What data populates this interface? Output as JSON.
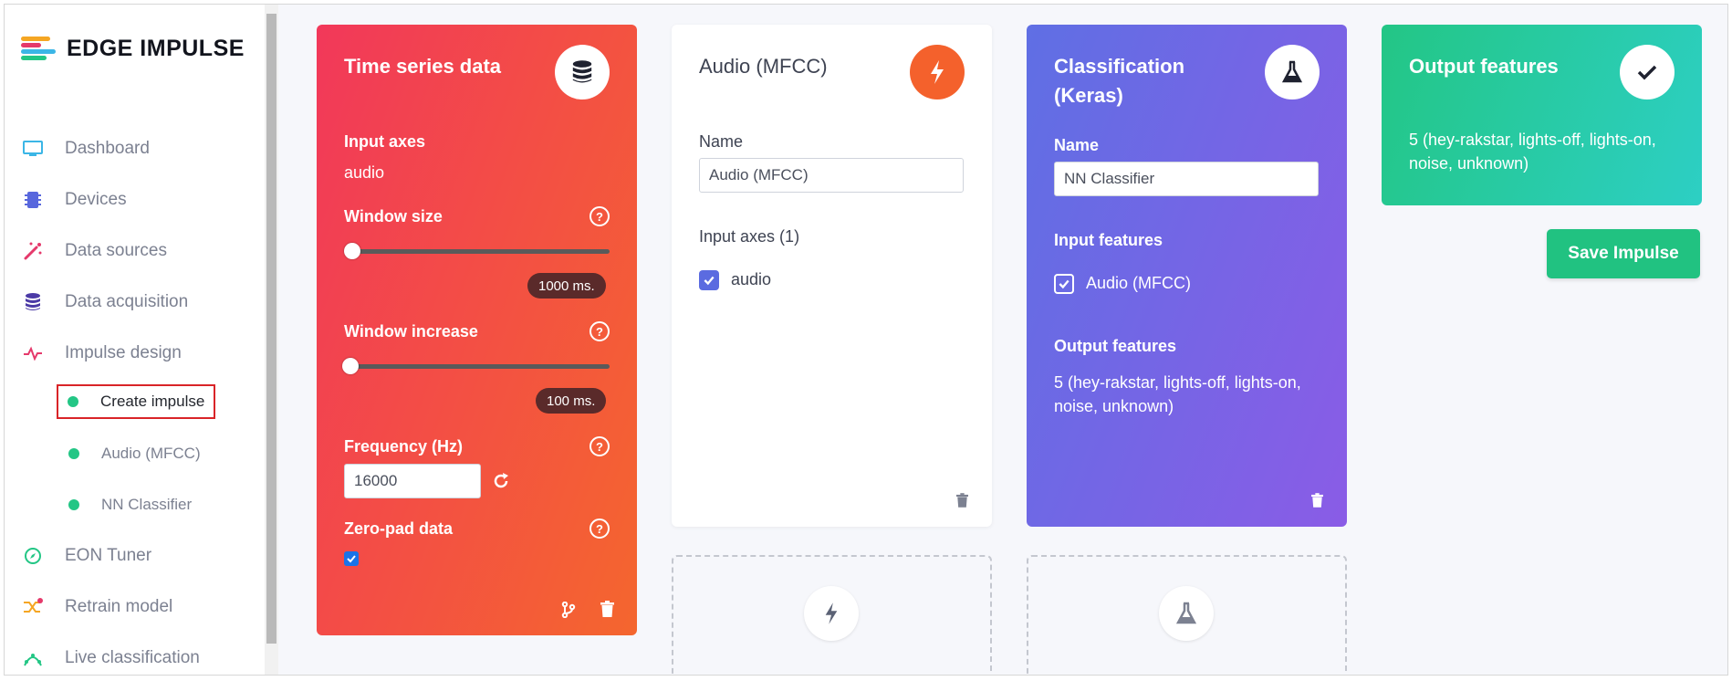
{
  "brand": {
    "name": "EDGE IMPULSE"
  },
  "sidebar": {
    "items": [
      {
        "label": "Dashboard",
        "icon": "monitor-icon",
        "color": "#3bb6e6"
      },
      {
        "label": "Devices",
        "icon": "chip-icon",
        "color": "#5867dd"
      },
      {
        "label": "Data sources",
        "icon": "magic-wand-icon",
        "color": "#e5396b"
      },
      {
        "label": "Data acquisition",
        "icon": "database-icon",
        "color": "#4b3aa6"
      },
      {
        "label": "Impulse design",
        "icon": "pulse-icon",
        "color": "#e5396b"
      }
    ],
    "sub_items": [
      {
        "label": "Create impulse"
      },
      {
        "label": "Audio (MFCC)"
      },
      {
        "label": "NN Classifier"
      }
    ],
    "items_after": [
      {
        "label": "EON Tuner",
        "icon": "compass-icon",
        "color": "#23c685"
      },
      {
        "label": "Retrain model",
        "icon": "shuffle-icon",
        "color": "#f5a623"
      },
      {
        "label": "Live classification",
        "icon": "network-icon",
        "color": "#23c685"
      }
    ]
  },
  "time_series": {
    "title": "Time series data",
    "input_axes_label": "Input axes",
    "input_axes_value": "audio",
    "window_size_label": "Window size",
    "window_size_value": "1000 ms.",
    "window_increase_label": "Window increase",
    "window_increase_value": "100 ms.",
    "frequency_label": "Frequency (Hz)",
    "frequency_value": "16000",
    "zero_pad_label": "Zero-pad data",
    "zero_pad_checked": true,
    "help_glyph": "?"
  },
  "mfcc": {
    "title": "Audio (MFCC)",
    "name_label": "Name",
    "name_value": "Audio (MFCC)",
    "input_axes_label": "Input axes (1)",
    "axis_name": "audio"
  },
  "classification": {
    "title_line1": "Classification",
    "title_line2": "(Keras)",
    "name_label": "Name",
    "name_value": "NN Classifier",
    "input_features_label": "Input features",
    "input_feature": "Audio (MFCC)",
    "output_features_label": "Output features",
    "output_features_line1": "5 (hey-rakstar, lights-off, lights-on,",
    "output_features_line2": "noise, unknown)"
  },
  "output": {
    "title": "Output features",
    "line1": "5 (hey-rakstar, lights-off, lights-on,",
    "line2": "noise, unknown)"
  },
  "save_button": "Save Impulse",
  "colors": {
    "time_series_gradient_start": "#f2385a",
    "time_series_gradient_end": "#f4662e",
    "classification_gradient_start": "#5f6fe4",
    "classification_gradient_end": "#8a5ce6",
    "output_gradient_start": "#23c685",
    "output_gradient_end": "#2dcfc4",
    "accent_green": "#21c281"
  }
}
